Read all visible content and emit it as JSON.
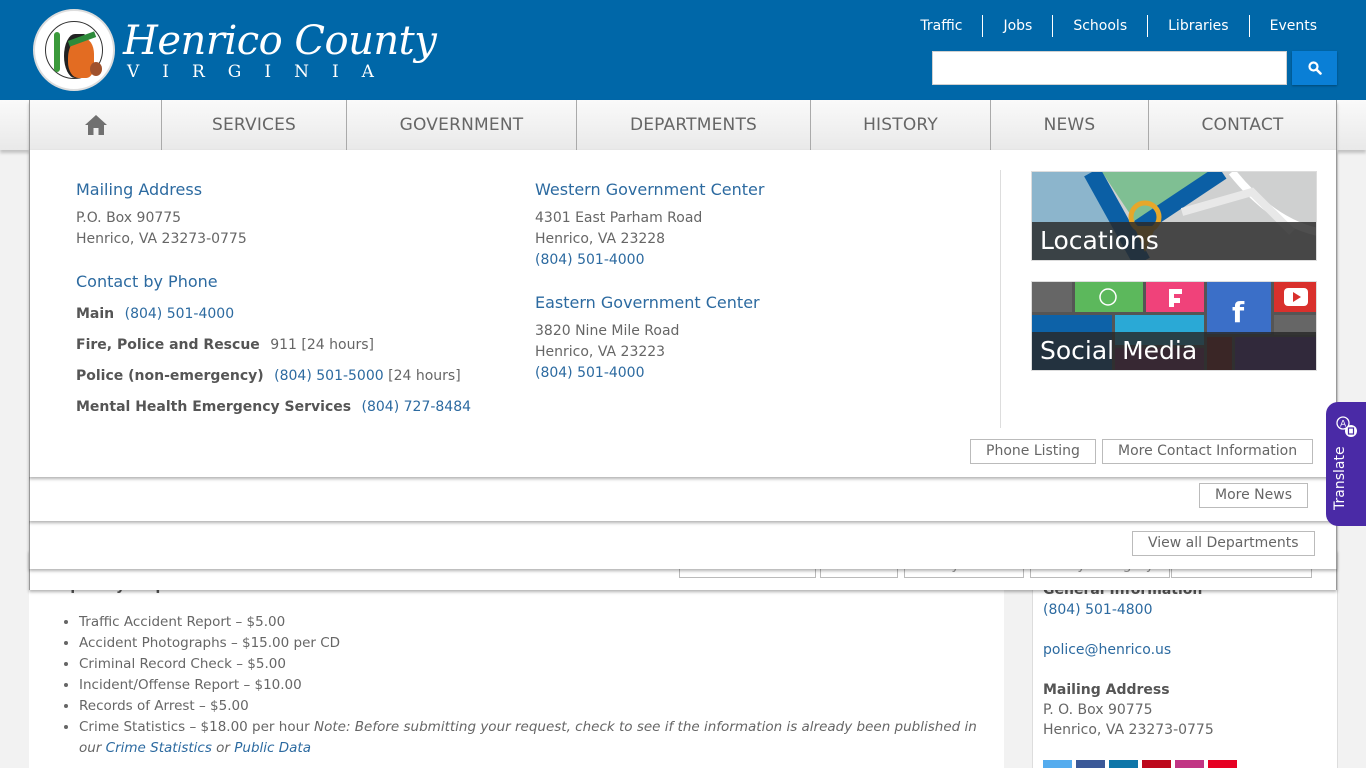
{
  "header": {
    "logo_title": "Henrico County",
    "logo_subtitle": "VIRGINIA",
    "seal_alt": "County of Henrico, Virginia seal",
    "utility_links": [
      "Traffic",
      "Jobs",
      "Schools",
      "Libraries",
      "Events"
    ],
    "search": {
      "value": "",
      "placeholder": "",
      "button_icon": "search-icon"
    },
    "brand_color": "#0067a8",
    "search_button_color": "#0a7fd6"
  },
  "nav": {
    "home_icon": "home-icon",
    "items": [
      "SERVICES",
      "GOVERNMENT",
      "DEPARTMENTS",
      "HISTORY",
      "NEWS",
      "CONTACT"
    ]
  },
  "contact_dropdown": {
    "mailing": {
      "heading": "Mailing Address",
      "line1": "P.O. Box 90775",
      "line2": "Henrico, VA 23273-0775"
    },
    "phone": {
      "heading": "Contact by Phone",
      "rows": [
        {
          "label": "Main",
          "link": "(804) 501-4000",
          "extra": ""
        },
        {
          "label": "Fire, Police and Rescue",
          "link": "",
          "extra": "911 [24 hours]"
        },
        {
          "label": "Police (non-emergency)",
          "link": "(804) 501-5000",
          "extra": " [24 hours]"
        },
        {
          "label": "Mental Health Emergency Services",
          "link": "(804) 727-8484",
          "extra": ""
        }
      ]
    },
    "western": {
      "heading": "Western Government Center",
      "line1": "4301 East Parham Road",
      "line2": "Henrico, VA 23228",
      "phone": "(804) 501-4000"
    },
    "eastern": {
      "heading": "Eastern Government Center",
      "line1": "3820 Nine Mile Road",
      "line2": "Henrico, VA 23223",
      "phone": "(804) 501-4000"
    },
    "tiles": {
      "locations": "Locations",
      "social": "Social Media"
    },
    "buttons": {
      "phone_listing": "Phone Listing",
      "more_contact": "More Contact Information"
    }
  },
  "news_dropdown": {
    "more_news": "More News"
  },
  "departments_dropdown": {
    "view_all": "View all Departments"
  },
  "services_dropdown": {
    "buttons": [
      "Services Home",
      "All A-Z",
      "All By Action",
      "All By Category",
      "Online Services"
    ]
  },
  "page": {
    "section_title": "Frequently Requested Records and Fees",
    "fees": [
      "Traffic Accident Report – $5.00",
      "Accident Photographs – $15.00 per CD",
      "Criminal Record Check – $5.00",
      "Incident/Offense Report  – $10.00",
      "Records of Arrest – $5.00"
    ],
    "crime_stats": {
      "text": "Crime Statistics – $18.00 per hour ",
      "note": "Note: Before submitting your request, check to see if the information is already been published in our ",
      "link1": "Crime Statistics",
      "or": " or ",
      "link2": "Public Data"
    },
    "sidebar": {
      "general_label": "General Information",
      "phone": "(804) 501-4800",
      "email": "police@henrico.us",
      "mailing_label": "Mailing Address",
      "mailing_line1": "P. O. Box 90775",
      "mailing_line2": "Henrico, VA 23273-0775",
      "social_colors": [
        "#55acee",
        "#3b5998",
        "#0e76a8",
        "#bd081c",
        "#c13584",
        "#e60023"
      ]
    }
  },
  "translate": {
    "label": "Translate",
    "color": "#4a2aa6"
  }
}
